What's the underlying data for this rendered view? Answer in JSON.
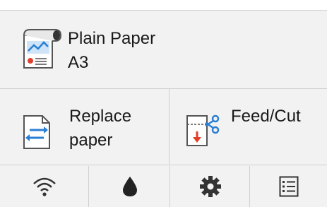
{
  "media": {
    "type_label": "Plain Paper",
    "size_label": "A3",
    "icon": "paper-roll-icon"
  },
  "actions": {
    "replace_label": "Replace paper",
    "replace_icon": "replace-arrows-icon",
    "feed_label": "Feed/Cut",
    "feed_icon": "scissors-icon"
  },
  "tabs": [
    {
      "icon": "wifi-icon"
    },
    {
      "icon": "ink-drop-icon"
    },
    {
      "icon": "gear-icon"
    },
    {
      "icon": "list-icon"
    }
  ],
  "colors": {
    "panel_bg": "#f2f2f2",
    "divider": "#cfcfcf",
    "accent_blue": "#2a7fd4",
    "accent_red": "#e0402a"
  }
}
